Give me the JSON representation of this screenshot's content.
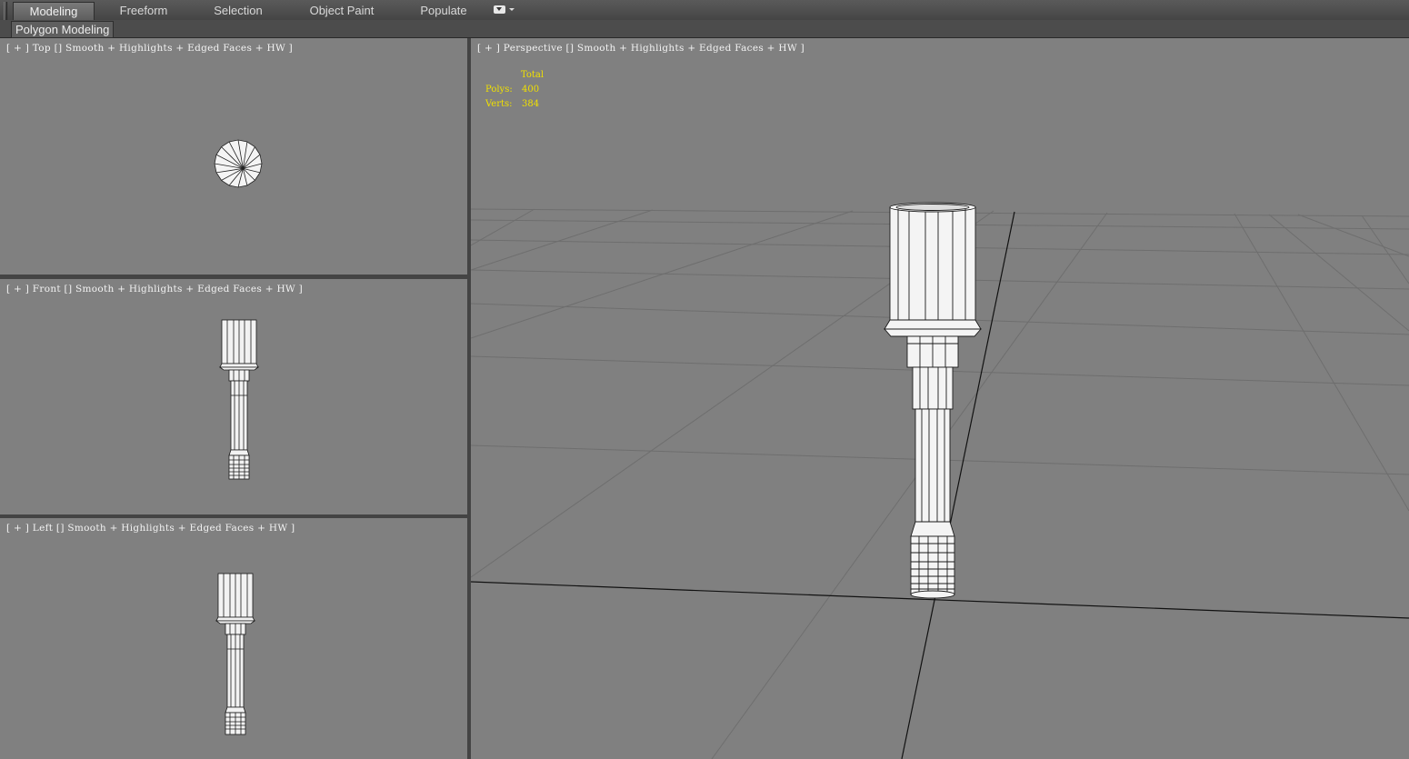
{
  "ribbon": {
    "tabs": [
      {
        "label": "Modeling",
        "active": true
      },
      {
        "label": "Freeform",
        "active": false
      },
      {
        "label": "Selection",
        "active": false
      },
      {
        "label": "Object Paint",
        "active": false
      },
      {
        "label": "Populate",
        "active": false
      }
    ],
    "dropdown_icon": "panel-dropdown-icon",
    "sub_panel": "Polygon Modeling"
  },
  "viewports": {
    "top": {
      "label": "[ + ] Top [] Smooth + Highlights + Edged Faces + HW ]"
    },
    "front": {
      "label": "[ + ] Front [] Smooth + Highlights + Edged Faces + HW ]"
    },
    "left": {
      "label": "[ + ] Left [] Smooth + Highlights + Edged Faces + HW ]"
    },
    "perspective": {
      "label": "[ + ] Perspective [] Smooth + Highlights + Edged Faces + HW ]",
      "stats": {
        "header": "Total",
        "polys_label": "Polys:",
        "polys_value": "400",
        "verts_label": "Verts:",
        "verts_value": "384"
      }
    }
  },
  "colors": {
    "viewport_bg": "#808080",
    "stats_text": "#f0e000",
    "label_text": "#f2f2f2",
    "chrome": "#444444"
  }
}
